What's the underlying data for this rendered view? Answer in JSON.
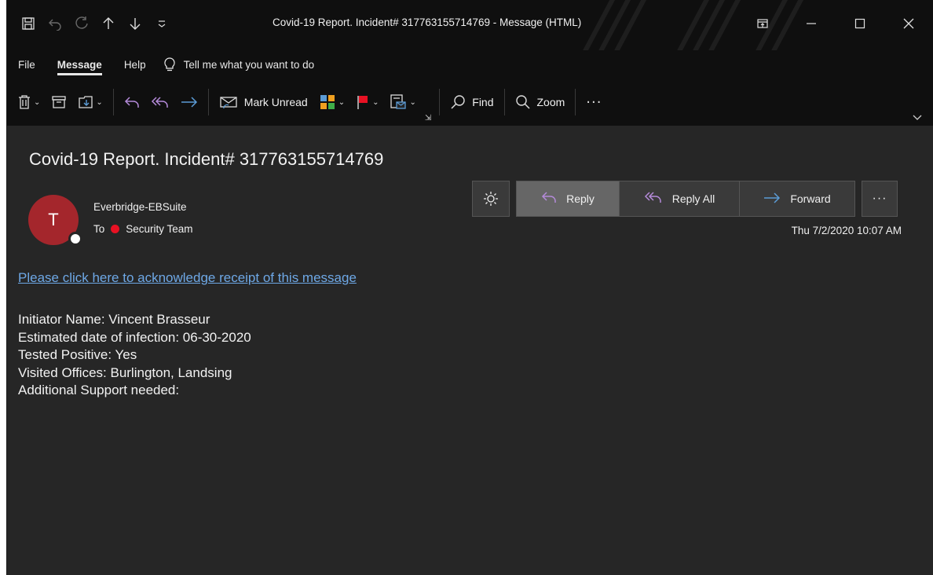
{
  "window": {
    "title": "Covid-19 Report. Incident# 317763155714769  -  Message (HTML)"
  },
  "quick_access": {
    "icons": [
      "save-icon",
      "undo-icon",
      "redo-icon",
      "up-arrow-icon",
      "down-arrow-icon",
      "customize-icon"
    ]
  },
  "menu": {
    "items": [
      {
        "label": "File"
      },
      {
        "label": "Message"
      },
      {
        "label": "Help"
      }
    ],
    "tellme_label": "Tell me what you want to do"
  },
  "ribbon": {
    "mark_unread_label": "Mark Unread",
    "find_label": "Find",
    "zoom_label": "Zoom",
    "more_label": "···"
  },
  "message": {
    "subject": "Covid-19 Report. Incident# 317763155714769",
    "avatar_initial": "T",
    "sender": "Everbridge-EBSuite",
    "to_prefix": "To",
    "recipient": "Security Team",
    "date": "Thu 7/2/2020 10:07 AM",
    "actions": {
      "reply_label": "Reply",
      "reply_all_label": "Reply All",
      "forward_label": "Forward",
      "more_label": "···"
    },
    "ack_link": "Please click here to acknowledge receipt of this message",
    "body_lines": [
      "Initiator Name: Vincent Brasseur",
      "Estimated date of infection: 06-30-2020",
      "Tested Positive: Yes",
      "Visited Offices: Burlington, Landsing",
      "Additional Support needed:"
    ]
  },
  "colors": {
    "background": "#262626",
    "titlebar": "#0f0f0f",
    "accent_blue": "#5b9bd5",
    "avatar": "#a4262c",
    "link": "#6ea8e6",
    "flag_red": "#e81123"
  }
}
